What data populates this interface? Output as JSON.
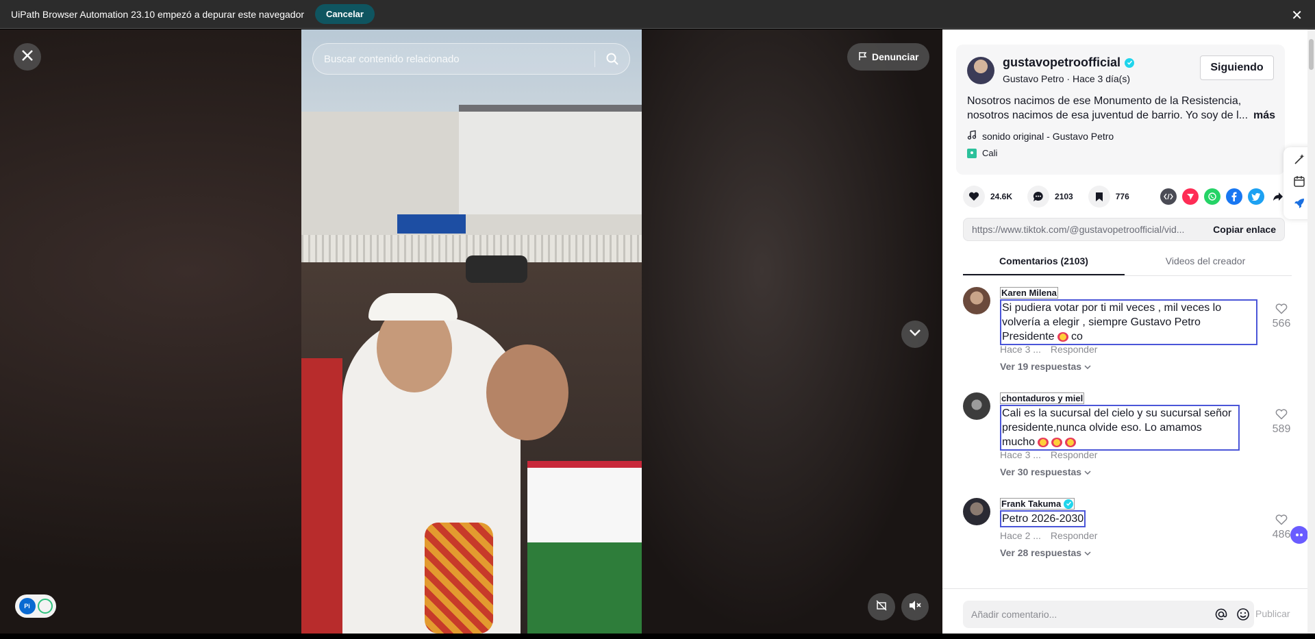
{
  "debug_bar": {
    "message": "UiPath Browser Automation 23.10 empezó a depurar este navegador",
    "cancel_label": "Cancelar",
    "close_glyph": "✕"
  },
  "video": {
    "search_placeholder": "Buscar contenido relacionado",
    "report_label": "Denunciar"
  },
  "post": {
    "username": "gustavopetroofficial",
    "display_name": "Gustavo Petro",
    "time_ago": "Hace 3 día(s)",
    "follow_label": "Siguiendo",
    "description_line1": "Nosotros nacimos de ese Monumento de la Resistencia,",
    "description_line2": "nosotros nacimos de esa juventud de barrio. Yo soy de l...",
    "more_label": "más",
    "sound": "sonido original - Gustavo Petro",
    "location": "Cali"
  },
  "stats": {
    "likes": "24.6K",
    "comments": "2103",
    "saves": "776"
  },
  "share": {
    "url": "https://www.tiktok.com/@gustavopetroofficial/vid...",
    "copy_label": "Copiar enlace"
  },
  "tabs": [
    {
      "label": "Comentarios (2103)"
    },
    {
      "label": "Videos del creador"
    }
  ],
  "comments": [
    {
      "user": "Karen Milena",
      "text": "Si pudiera votar por ti mil veces , mil veces lo volvería a elegir , siempre Gustavo Petro Presidente",
      "text_suffix": "co",
      "time": "Hace 3 ...",
      "reply_label": "Responder",
      "replies_label": "Ver 19 respuestas",
      "likes": "566"
    },
    {
      "user": "chontaduros y miel",
      "text": "Cali es la sucursal del cielo y su sucursal señor presidente,nunca olvide eso. Lo amamos mucho",
      "text_suffix": "",
      "time": "Hace 3 ...",
      "reply_label": "Responder",
      "replies_label": "Ver 30 respuestas",
      "likes": "589"
    },
    {
      "user": "Frank Takuma",
      "text": "Petro 2026-2030",
      "text_suffix": "",
      "time": "Hace 2 ...",
      "reply_label": "Responder",
      "replies_label": "Ver 28 respuestas",
      "likes": "486"
    }
  ],
  "footer": {
    "comment_placeholder": "Añadir comentario...",
    "publish_label": "Publicar"
  },
  "colors": {
    "verified": "#20d5ec",
    "cancel_button": "#0f5560",
    "annotation_outline": "#4a55d8"
  },
  "icons": [
    "close-icon",
    "search-icon",
    "flag-icon",
    "chevron-down-icon",
    "pip-off-icon",
    "mute-icon",
    "heart-icon",
    "comment-icon",
    "bookmark-icon",
    "embed-icon",
    "send-icon",
    "whatsapp-icon",
    "facebook-icon",
    "twitter-icon",
    "share-icon",
    "music-icon",
    "location-icon",
    "at-icon",
    "emoji-icon"
  ]
}
